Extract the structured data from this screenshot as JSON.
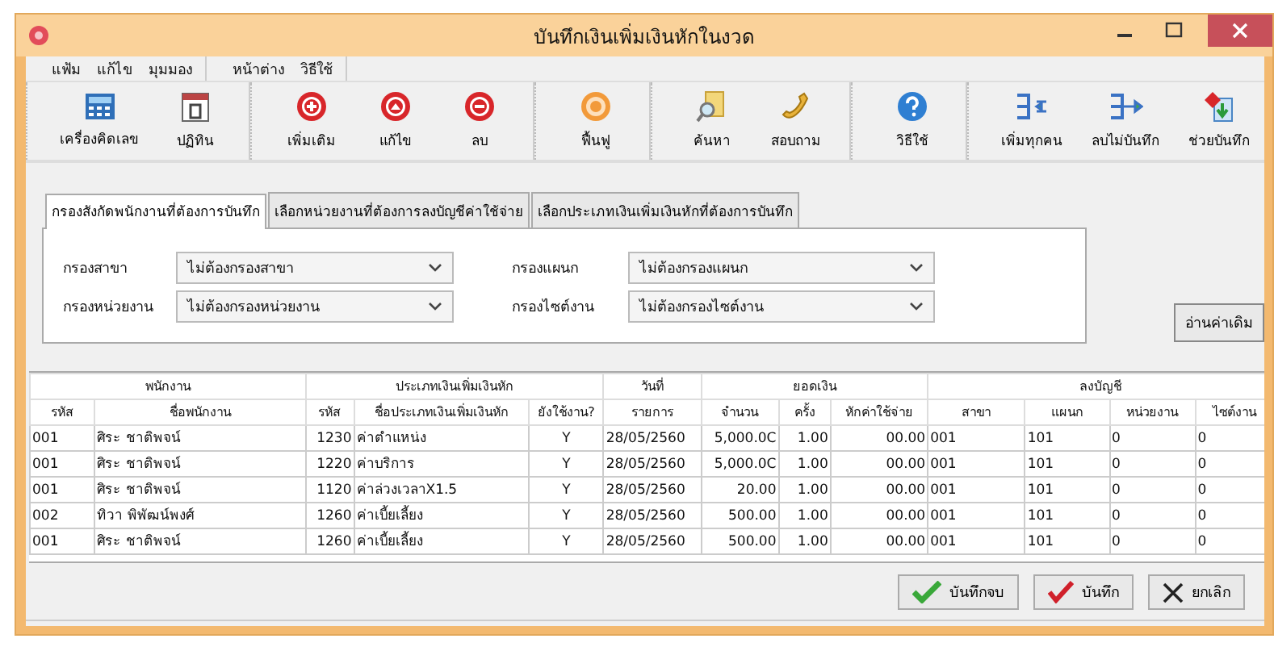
{
  "window": {
    "title": "บันทึกเงินเพิ่มเงินหักในงวด"
  },
  "menu_groups": [
    [
      "แฟ้ม",
      "แก้ไข",
      "มุมมอง"
    ],
    [
      "หน้าต่าง",
      "วิธีใช้"
    ]
  ],
  "toolbar_groups": [
    [
      {
        "label": "เครื่องคิดเลข",
        "kind": "calculator"
      },
      {
        "label": "ปฏิทิน",
        "kind": "calendar"
      }
    ],
    [
      {
        "label": "เพิ่มเติม",
        "kind": "add"
      },
      {
        "label": "แก้ไข",
        "kind": "edit"
      },
      {
        "label": "ลบ",
        "kind": "delete"
      }
    ],
    [
      {
        "label": "ฟื้นฟู",
        "kind": "refresh"
      }
    ],
    [
      {
        "label": "ค้นหา",
        "kind": "search"
      },
      {
        "label": "สอบถาม",
        "kind": "phone"
      }
    ],
    [
      {
        "label": "วิธีใช้",
        "kind": "help"
      }
    ],
    [
      {
        "label": "เพิ่มทุกคน",
        "kind": "addall"
      },
      {
        "label": "ลบไม่บันทึก",
        "kind": "remove"
      },
      {
        "label": "ช่วยบันทึก",
        "kind": "assist"
      }
    ]
  ],
  "tabs": [
    {
      "label": "กรองสังกัดพนักงานที่ต้องการบันทึก",
      "selected": true
    },
    {
      "label": "เลือกหน่วยงานที่ต้องการลงบัญชีค่าใช้จ่าย",
      "selected": false
    },
    {
      "label": "เลือกประเภทเงินเพิ่มเงินหักที่ต้องการบันทึก",
      "selected": false
    }
  ],
  "filters": [
    {
      "label": "กรองสาขา",
      "value": "ไม่ต้องกรองสาขา"
    },
    {
      "label": "กรองแผนก",
      "value": "ไม่ต้องกรองแผนก"
    },
    {
      "label": "กรองหน่วยงาน",
      "value": "ไม่ต้องกรองหน่วยงาน"
    },
    {
      "label": "กรองไซต์งาน",
      "value": "ไม่ต้องกรองไซต์งาน"
    }
  ],
  "read_button": "อ่านค่าเดิม",
  "table": {
    "column_groups": [
      "พนักงาน",
      "ประเภทเงินเพิ่มเงินหัก",
      "วันที่",
      "ยอดเงิน",
      "ลงบัญชี"
    ],
    "columns": [
      "รหัส",
      "ชื่อพนักงาน",
      "รหัส",
      "ชื่อประเภทเงินเพิ่มเงินหัก",
      "ยังใช้งาน?",
      "รายการ",
      "จำนวน",
      "ครั้ง",
      "หักค่าใช้จ่าย",
      "สาขา",
      "แผนก",
      "หน่วยงาน",
      "ไซต์งาน"
    ],
    "rows": [
      [
        "001",
        "ศิระ  ชาติพจน์",
        "1230",
        "ค่าตำแหน่ง",
        "Y",
        "28/05/2560",
        "5,000.0C",
        "1.00",
        "00.00",
        "001",
        "101",
        "0",
        "0"
      ],
      [
        "001",
        "ศิระ  ชาติพจน์",
        "1220",
        "ค่าบริการ",
        "Y",
        "28/05/2560",
        "5,000.0C",
        "1.00",
        "00.00",
        "001",
        "101",
        "0",
        "0"
      ],
      [
        "001",
        "ศิระ  ชาติพจน์",
        "1120",
        "ค่าล่วงเวลาX1.5",
        "Y",
        "28/05/2560",
        "20.00",
        "1.00",
        "00.00",
        "001",
        "101",
        "0",
        "0"
      ],
      [
        "002",
        "ทิวา  พิพัฒน์พงศ์",
        "1260",
        "ค่าเบี้ยเลี้ยง",
        "Y",
        "28/05/2560",
        "500.00",
        "1.00",
        "00.00",
        "001",
        "101",
        "0",
        "0"
      ],
      [
        "001",
        "ศิระ  ชาติพจน์",
        "1260",
        "ค่าเบี้ยเลี้ยง",
        "Y",
        "28/05/2560",
        "500.00",
        "1.00",
        "00.00",
        "001",
        "101",
        "0",
        "0"
      ]
    ]
  },
  "buttons": [
    {
      "label": "บันทึกจบ",
      "kind": "save_close"
    },
    {
      "label": "บันทึก",
      "kind": "save"
    },
    {
      "label": "ยกเลิก",
      "kind": "cancel"
    }
  ]
}
